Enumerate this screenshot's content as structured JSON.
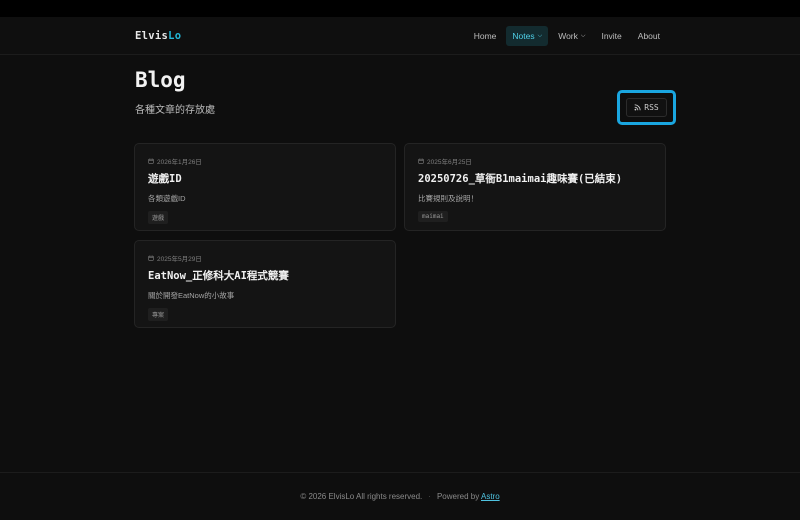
{
  "header": {
    "logo_part1": "Elvis",
    "logo_part2": "Lo",
    "nav": [
      {
        "label": "Home"
      },
      {
        "label": "Notes"
      },
      {
        "label": "Work"
      },
      {
        "label": "Invite"
      },
      {
        "label": "About"
      }
    ],
    "active_nav": "Notes",
    "accent_color": "#22b8d8"
  },
  "page": {
    "title": "Blog",
    "subtitle": "各種文章的存放處",
    "rss_label": "RSS"
  },
  "posts": [
    {
      "date": "2026年1月26日",
      "title": "遊戲ID",
      "description": "各類遊戲ID",
      "tag": "遊戲"
    },
    {
      "date": "2025年6月25日",
      "title": "20250726_草衙B1maimai趣味賽(已結束)",
      "description": "比賽規則及說明！",
      "tag": "maimai"
    },
    {
      "date": "2025年5月29日",
      "title": "EatNow_正修科大AI程式競賽",
      "description": "關於開發EatNow的小故事",
      "tag": "專案"
    }
  ],
  "footer": {
    "copyright": "© 2026 ElvisLo All rights reserved.",
    "powered_prefix": "Powered by",
    "powered_link": "Astro"
  }
}
